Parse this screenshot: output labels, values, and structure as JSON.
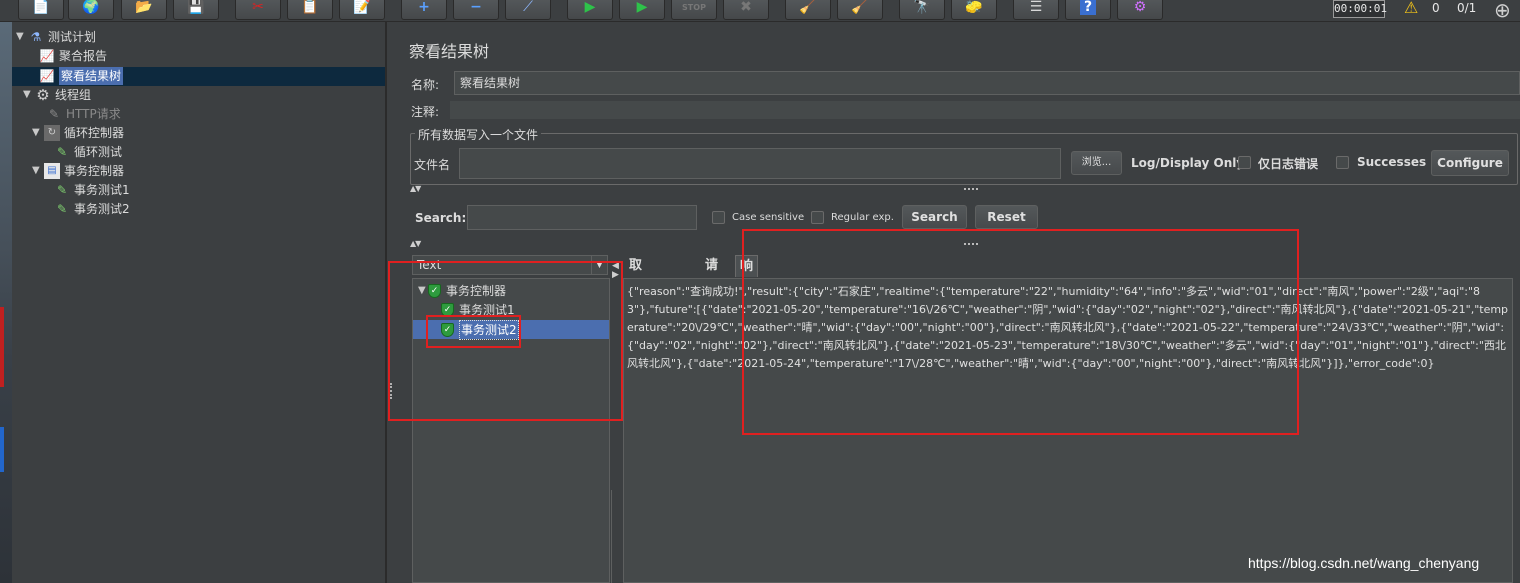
{
  "toolbar": {
    "buttons": [
      {
        "name": "new-icon",
        "glyph": "📄"
      },
      {
        "name": "templates-icon",
        "glyph": "🌍"
      },
      {
        "name": "open-icon",
        "glyph": "📂"
      },
      {
        "name": "save-icon",
        "glyph": "💾"
      },
      {
        "name": "cut-icon",
        "glyph": "✂"
      },
      {
        "name": "copy-icon",
        "glyph": "📋"
      },
      {
        "name": "paste-icon",
        "glyph": "📝"
      },
      {
        "name": "expand-icon",
        "glyph": "+"
      },
      {
        "name": "collapse-icon",
        "glyph": "−"
      },
      {
        "name": "toggle-icon",
        "glyph": "⟋"
      },
      {
        "name": "start-icon",
        "glyph": "▶"
      },
      {
        "name": "start-no-pause-icon",
        "glyph": "▶"
      },
      {
        "name": "stop-icon",
        "glyph": "STOP"
      },
      {
        "name": "shutdown-icon",
        "glyph": "✖"
      },
      {
        "name": "clear-icon",
        "glyph": "🧹"
      },
      {
        "name": "clear-all-icon",
        "glyph": "🧹"
      },
      {
        "name": "search-icon",
        "glyph": "🔭"
      },
      {
        "name": "reset-search-icon",
        "glyph": "🧽"
      },
      {
        "name": "function-helper-icon",
        "glyph": "☰"
      },
      {
        "name": "help-icon",
        "glyph": "?"
      },
      {
        "name": "remote-icon",
        "glyph": "⚙"
      }
    ],
    "timer": "00:00:01",
    "warning_count": "0",
    "threads_ratio": "0/1",
    "warning_color": "#f5c518"
  },
  "tree": {
    "items": [
      {
        "label": "测试计划",
        "icon": "flask-icon"
      },
      {
        "label": "聚合报告",
        "icon": "chart-icon"
      },
      {
        "label": "察看结果树",
        "icon": "chart-icon"
      },
      {
        "label": "线程组",
        "icon": "gear-icon"
      },
      {
        "label": "HTTP请求",
        "icon": "pencil-icon"
      },
      {
        "label": "循环控制器",
        "icon": "loop-icon"
      },
      {
        "label": "循环测试",
        "icon": "pencil-icon"
      },
      {
        "label": "事务控制器",
        "icon": "transaction-icon"
      },
      {
        "label": "事务测试1",
        "icon": "pencil-icon"
      },
      {
        "label": "事务测试2",
        "icon": "pencil-icon"
      }
    ]
  },
  "panel": {
    "title": "察看结果树",
    "name_label": "名称:",
    "name_value": "察看结果树",
    "comment_label": "注释:",
    "fieldset_legend": "所有数据写入一个文件",
    "filename_label": "文件名",
    "browse_label": "浏览...",
    "log_display_label": "Log/Display Only:",
    "errors_only_label": "仅日志错误",
    "successes_label": "Successes",
    "configure_label": "Configure",
    "search_label": "Search:",
    "case_sensitive_label": "Case sensitive",
    "regex_label": "Regular exp.",
    "search_button": "Search",
    "reset_button": "Reset",
    "renderer_value": "Text",
    "results": [
      {
        "label": "事务控制器"
      },
      {
        "label": "事务测试1"
      },
      {
        "label": "事务测试2"
      }
    ],
    "tabs": [
      {
        "label": "取样器结果"
      },
      {
        "label": "请求"
      },
      {
        "label": "响应数据"
      }
    ],
    "response_text": "{\"reason\":\"查询成功!\",\"result\":{\"city\":\"石家庄\",\"realtime\":{\"temperature\":\"22\",\"humidity\":\"64\",\"info\":\"多云\",\"wid\":\"01\",\"direct\":\"南风\",\"power\":\"2级\",\"aqi\":\"83\"},\"future\":[{\"date\":\"2021-05-20\",\"temperature\":\"16\\/26℃\",\"weather\":\"阴\",\"wid\":{\"day\":\"02\",\"night\":\"02\"},\"direct\":\"南风转北风\"},{\"date\":\"2021-05-21\",\"temperature\":\"20\\/29℃\",\"weather\":\"晴\",\"wid\":{\"day\":\"00\",\"night\":\"00\"},\"direct\":\"南风转北风\"},{\"date\":\"2021-05-22\",\"temperature\":\"24\\/33℃\",\"weather\":\"阴\",\"wid\":{\"day\":\"02\",\"night\":\"02\"},\"direct\":\"南风转北风\"},{\"date\":\"2021-05-23\",\"temperature\":\"18\\/30℃\",\"weather\":\"多云\",\"wid\":{\"day\":\"01\",\"night\":\"01\"},\"direct\":\"西北风转北风\"},{\"date\":\"2021-05-24\",\"temperature\":\"17\\/28℃\",\"weather\":\"晴\",\"wid\":{\"day\":\"00\",\"night\":\"00\"},\"direct\":\"南风转北风\"}]},\"error_code\":0}"
  },
  "watermark": "https://blog.csdn.net/wang_chenyang",
  "colors": {
    "background": "#3c3f41",
    "selection": "#4b6eaf",
    "success_green": "#2e9b3e",
    "annotation_red": "#e02020"
  }
}
